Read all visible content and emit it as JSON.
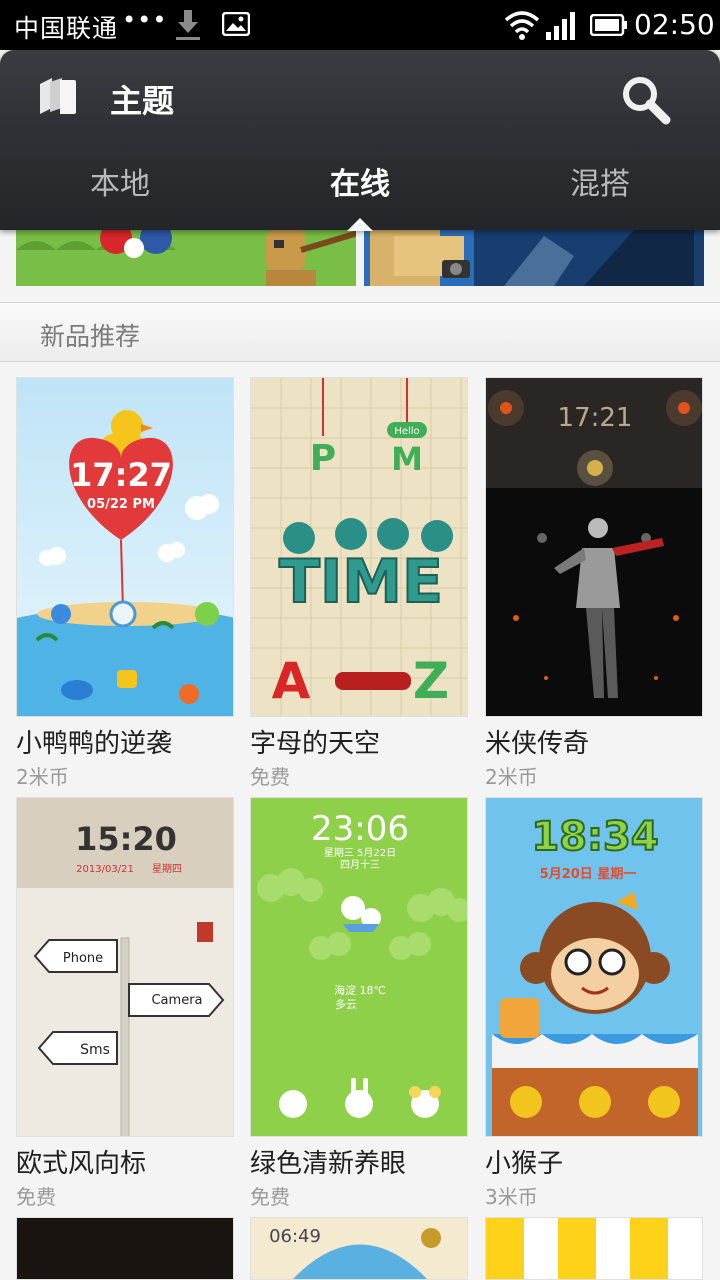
{
  "status_bar": {
    "carrier": "中国联通",
    "dots": "•••",
    "time": "02:50"
  },
  "header": {
    "title": "主题",
    "tabs": [
      "本地",
      "在线",
      "混搭"
    ],
    "active_tab": "在线"
  },
  "section": {
    "title": "新品推荐"
  },
  "themes": [
    {
      "name": "小鸭鸭的逆袭",
      "price": "2米币",
      "clock": "17:27",
      "date": "05/22 PM"
    },
    {
      "name": "字母的天空",
      "price": "免费",
      "letters": [
        "P",
        "M",
        "TIME",
        "A",
        "Z"
      ],
      "badge": "Hello"
    },
    {
      "name": "米侠传奇",
      "price": "2米币",
      "clock": "17:21"
    },
    {
      "name": "欧式风向标",
      "price": "免费",
      "clock": "15:20",
      "date": "2013/03/21",
      "weekday": "星期四",
      "signs": [
        "Phone",
        "Camera",
        "Sms"
      ]
    },
    {
      "name": "绿色清新养眼",
      "price": "免费",
      "clock": "23:06",
      "date": "星期三 5月22日",
      "lunar": "四月十三",
      "weather": "海淀 18℃",
      "weather2": "多云"
    },
    {
      "name": "小猴子",
      "price": "3米币",
      "clock": "18:34",
      "date": "5月20日 星期一"
    }
  ],
  "partial_row": {
    "clock": "06:49"
  }
}
